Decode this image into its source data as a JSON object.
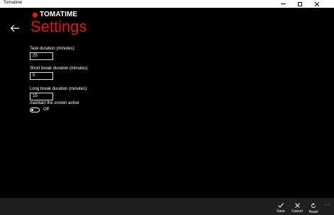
{
  "window": {
    "title": "Tomatime"
  },
  "brand": {
    "logo_text": "TOMATIME"
  },
  "page": {
    "title": "Settings"
  },
  "settings": {
    "task_label": "Task duration (minutes):",
    "task_value": "25",
    "short_label": "Short break duration (minutes):",
    "short_value": "5",
    "long_label": "Long break duration (minutes):",
    "long_value": "15",
    "screen_label": "maintain the screen active",
    "screen_state": "Off"
  },
  "appbar": {
    "save_label": "Save",
    "cancel_label": "Cancel",
    "reset_label": "Reset",
    "more_label": "..."
  },
  "colors": {
    "accent": "#e0141e",
    "background": "#000000",
    "appbar": "#1f1f1f"
  }
}
